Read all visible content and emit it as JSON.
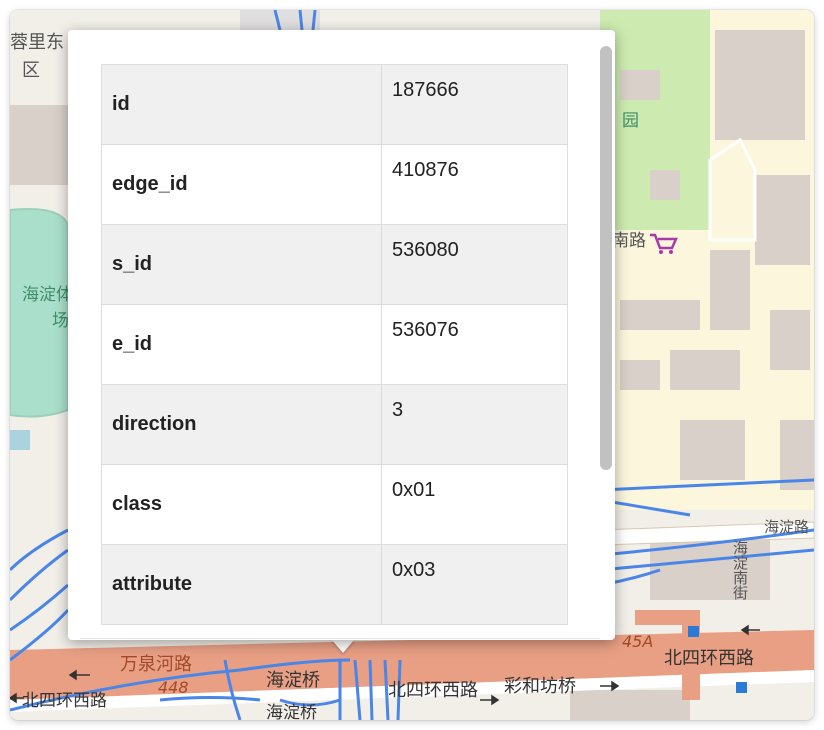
{
  "map": {
    "labels": {
      "district_top": "蓉里东",
      "district_top_2": "区",
      "stadium_1": "海淀体",
      "stadium_2": "场",
      "garden": "园",
      "road_south": "南路",
      "haidian_road": "海淀路",
      "vertical_street": "海淀南街",
      "road_45a": "45A",
      "beisihuan_east": "北四环西路",
      "wanquanhe": "万泉河路",
      "haidian_bridge": "海淀桥",
      "road_448": "448",
      "beisihuan_left": "北四环西路",
      "beisihuan_mid": "北四环西路",
      "caihefang": "彩和坊桥",
      "haidian_bridge_2": "海淀桥"
    },
    "colors": {
      "background": "#f2efe9",
      "residential": "#e0dfdf",
      "building": "#d9d0c9",
      "park": "#c8facc",
      "pitch": "#aae0cb",
      "highway": "#e89f84",
      "road_casing": "#d7c8b0",
      "route_line": "#4a86e8"
    },
    "icons": [
      "shopping-cart-icon",
      "bus-stop-icon"
    ]
  },
  "popup": {
    "rows": [
      {
        "key": "id",
        "value": "187666"
      },
      {
        "key": "edge_id",
        "value": "410876"
      },
      {
        "key": "s_id",
        "value": "536080"
      },
      {
        "key": "e_id",
        "value": "536076"
      },
      {
        "key": "direction",
        "value": "3"
      },
      {
        "key": "class",
        "value": "0x01"
      },
      {
        "key": "attribute",
        "value": "0x03"
      }
    ]
  }
}
